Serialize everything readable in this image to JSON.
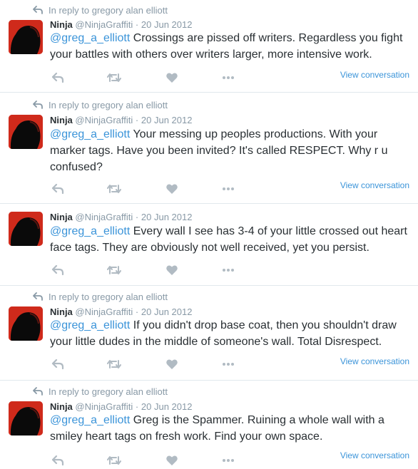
{
  "colors": {
    "link": "#3b94d9",
    "muted": "#8899a6",
    "text": "#292f33",
    "icon": "#b1bbc3",
    "avatar_bg": "#cf2a1b"
  },
  "tweets": [
    {
      "reply_prefix": "In reply to",
      "reply_to": "gregory alan elliott",
      "name": "Ninja",
      "handle": "@NinjaGraffiti",
      "separator": "·",
      "date": "20 Jun 2012",
      "mention": "@greg_a_elliott",
      "body": " Crossings are pissed off writers. Regardless you fight your battles with others over writers larger, more intensive work.",
      "view_conversation": "View conversation"
    },
    {
      "reply_prefix": "In reply to",
      "reply_to": "gregory alan elliott",
      "name": "Ninja",
      "handle": "@NinjaGraffiti",
      "separator": "·",
      "date": "20 Jun 2012",
      "mention": "@greg_a_elliott",
      "body": " Your messing up peoples productions. With your marker tags. Have you been invited? It's called RESPECT. Why r u confused?",
      "view_conversation": "View conversation"
    },
    {
      "name": "Ninja",
      "handle": "@NinjaGraffiti",
      "separator": "·",
      "date": "20 Jun 2012",
      "mention": "@greg_a_elliott",
      "body": " Every wall I see has 3-4 of your little crossed out heart face tags.  They are obviously not well received, yet you persist."
    },
    {
      "reply_prefix": "In reply to",
      "reply_to": "gregory alan elliott",
      "name": "Ninja",
      "handle": "@NinjaGraffiti",
      "separator": "·",
      "date": "20 Jun 2012",
      "mention": "@greg_a_elliott",
      "body": " If you didn't drop base coat, then you shouldn't draw your little dudes in the middle of someone's wall. Total Disrespect.",
      "view_conversation": "View conversation"
    },
    {
      "reply_prefix": "In reply to",
      "reply_to": "gregory alan elliott",
      "name": "Ninja",
      "handle": "@NinjaGraffiti",
      "separator": "·",
      "date": "20 Jun 2012",
      "mention": "@greg_a_elliott",
      "body": " Greg is the Spammer. Ruining a whole wall with a smiley heart tags on fresh work.  Find your own space.",
      "view_conversation": "View conversation"
    }
  ]
}
